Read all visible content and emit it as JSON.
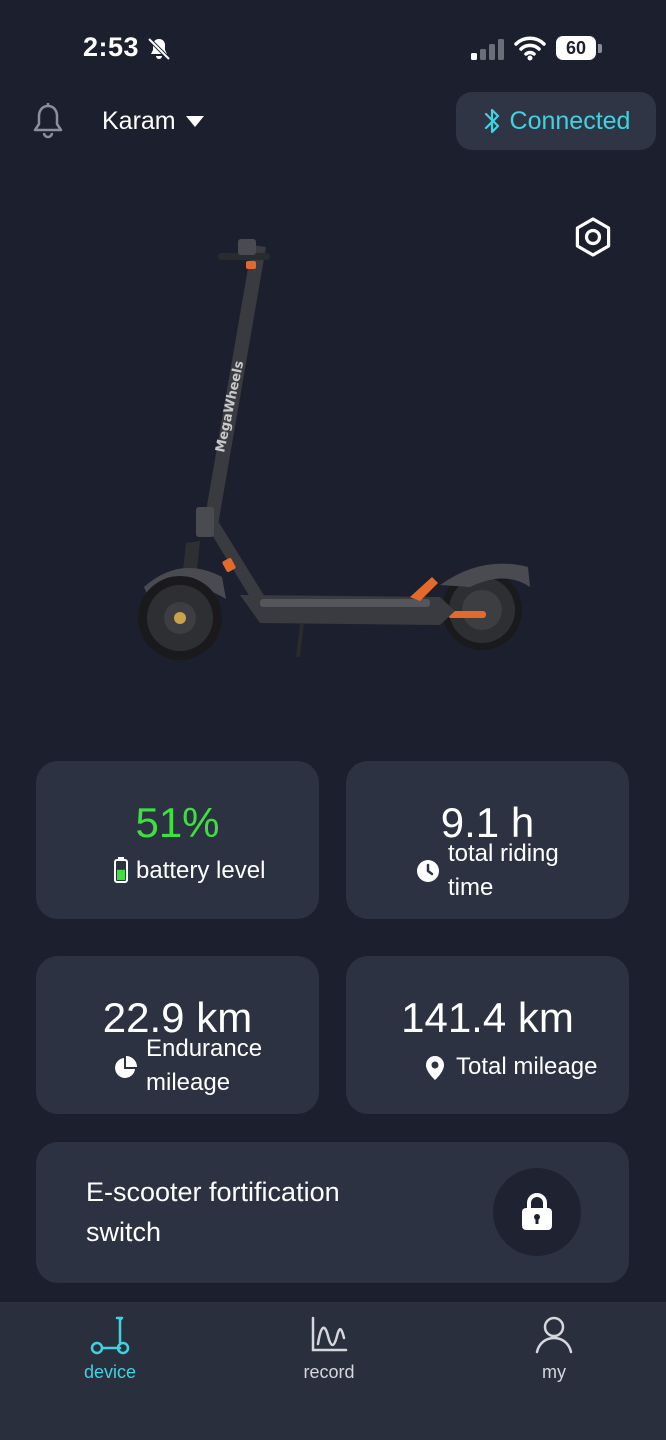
{
  "status_bar": {
    "time": "2:53",
    "battery_percent": "60",
    "icons": [
      "bell-mute-icon",
      "signal-icon",
      "wifi-icon",
      "battery-icon"
    ]
  },
  "header": {
    "user_name": "Karam",
    "connection_status": "Connected",
    "icons": [
      "bell-icon",
      "chevron-down-icon",
      "bluetooth-icon",
      "settings-icon"
    ]
  },
  "scooter": {
    "brand_text": "MegaWheels"
  },
  "stats": {
    "battery": {
      "value": "51%",
      "label": "battery level",
      "level": 0.51,
      "icon": "battery-icon"
    },
    "riding_time": {
      "value": "9.1 h",
      "label_line1": "total riding",
      "label_line2": "time",
      "icon": "clock-icon"
    },
    "endurance": {
      "value": "22.9 km",
      "label_line1": "Endurance",
      "label_line2": "mileage",
      "icon": "pie-icon"
    },
    "total_mileage": {
      "value": "141.4 km",
      "label": "Total mileage",
      "icon": "location-pin-icon"
    }
  },
  "fortification": {
    "label_line1": "E-scooter fortification",
    "label_line2": "switch",
    "icon": "lock-icon"
  },
  "nav": {
    "items": [
      {
        "label": "device",
        "icon": "scooter-icon",
        "active": true
      },
      {
        "label": "record",
        "icon": "chart-line-icon",
        "active": false
      },
      {
        "label": "my",
        "icon": "user-icon",
        "active": false
      }
    ]
  },
  "colors": {
    "background": "#1c1f2e",
    "card": "#2c3242",
    "accent": "#3ed3e0",
    "battery_green": "#3ee03e"
  }
}
